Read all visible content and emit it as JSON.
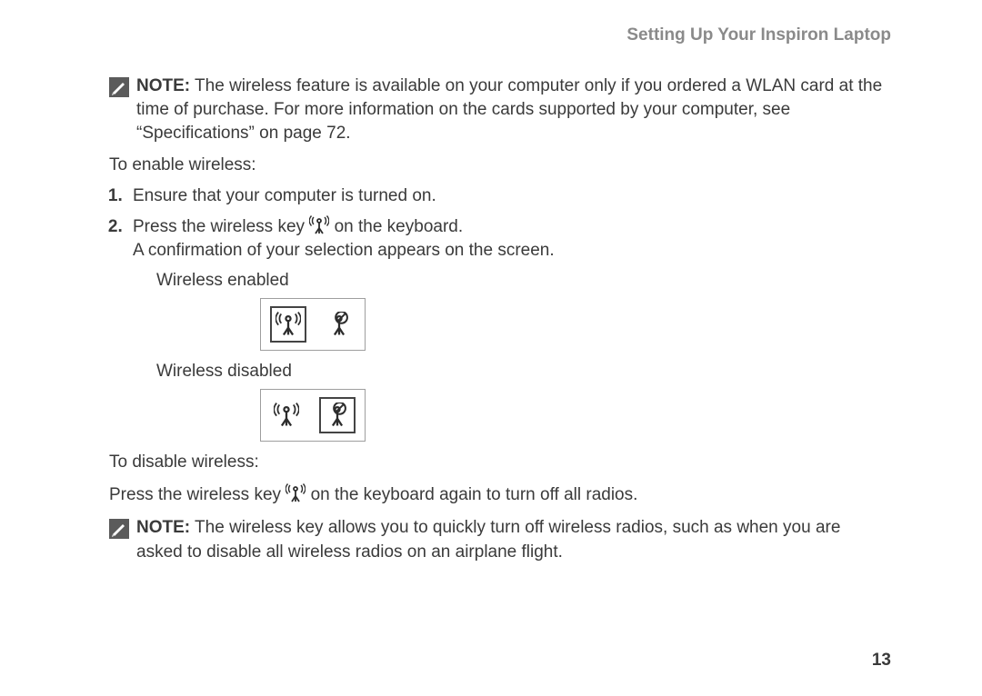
{
  "header": "Setting Up Your Inspiron Laptop",
  "note1": {
    "label": "NOTE:",
    "text": " The wireless feature is available on your computer only if you ordered a WLAN card at the time of purchase. For more information on the cards supported by your computer, see “Specifications” on page 72."
  },
  "enable_intro": "To enable wireless:",
  "step1": "Ensure that your computer is turned on.",
  "step2_a": "Press the wireless key ",
  "step2_b": " on the keyboard.",
  "step2_confirm": "A confirmation of your selection appears on the screen.",
  "wireless_enabled": "Wireless enabled",
  "wireless_disabled": "Wireless disabled",
  "disable_intro": "To disable wireless:",
  "disable_a": "Press the wireless key ",
  "disable_b": " on the keyboard again to turn off all radios.",
  "note2": {
    "label": "NOTE:",
    "text": "  The wireless key allows you to quickly turn off wireless radios, such as when you are asked to disable all wireless radios on an airplane flight."
  },
  "page_number": "13"
}
